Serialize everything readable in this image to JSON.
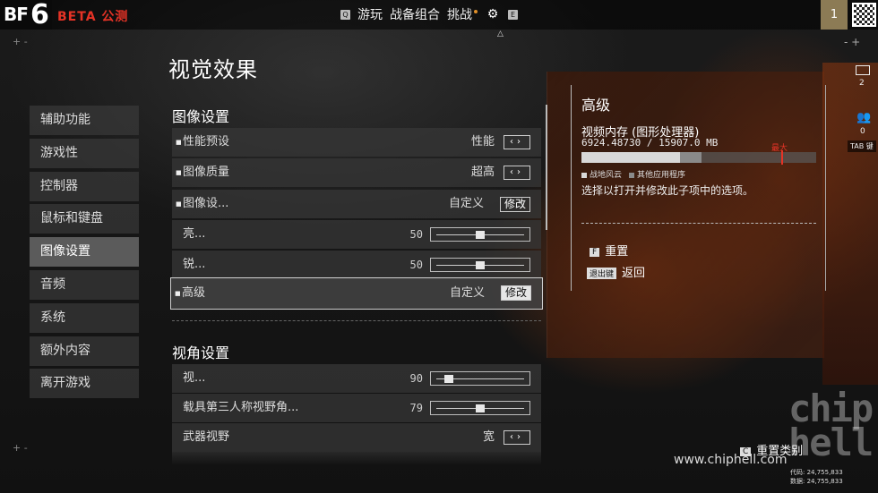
{
  "header": {
    "logo_bf": "BF",
    "logo_6": "6",
    "beta_label": "BETA 公测",
    "nav": [
      {
        "key": "Q",
        "label": "游玩"
      },
      {
        "key": "",
        "label": "战备组合"
      },
      {
        "key": "",
        "label": "挑战"
      },
      {
        "key": "E",
        "label": ""
      }
    ],
    "gear_key": "△",
    "level": "1",
    "zoom_out": "+ -",
    "zoom_in": "- +"
  },
  "page_title": "视觉效果",
  "sidebar": {
    "items": [
      {
        "label": "辅助功能",
        "active": false
      },
      {
        "label": "游戏性",
        "active": false
      },
      {
        "label": "控制器",
        "active": false
      },
      {
        "label": "鼠标和键盘",
        "active": false
      },
      {
        "label": "图像设置",
        "active": true
      },
      {
        "label": "音频",
        "active": false
      },
      {
        "label": "系统",
        "active": false
      },
      {
        "label": "额外内容",
        "active": false
      },
      {
        "label": "离开游戏",
        "active": false
      }
    ]
  },
  "image_settings": {
    "title": "图像设置",
    "rows": [
      {
        "label": "性能预设",
        "value": "性能",
        "control": "arrows"
      },
      {
        "label": "图像质量",
        "value": "超高",
        "control": "arrows"
      },
      {
        "label": "图像设...",
        "value": "自定义",
        "button": "修改"
      },
      {
        "label": "亮...",
        "number": "50",
        "slider": 0.5
      },
      {
        "label": "锐...",
        "number": "50",
        "slider": 0.5
      },
      {
        "label": "高级",
        "value": "自定义",
        "button": "修改"
      }
    ]
  },
  "view_settings": {
    "title": "视角设置",
    "rows": [
      {
        "label": "视...",
        "number": "90",
        "slider": 0.1
      },
      {
        "label": "载具第三人称视野角...",
        "number": "79",
        "slider": 0.5
      },
      {
        "label": "武器视野",
        "value": "宽",
        "control": "arrows"
      }
    ]
  },
  "right_panel": {
    "title": "高级",
    "vram_label": "视频内存 (图形处理器)",
    "vram_values": "6924.48730 / 15907.0 MB",
    "max_label": "最大",
    "vram": {
      "used_fraction": 0.42,
      "other_fraction": 0.09,
      "max_fraction": 0.85
    },
    "legend": [
      {
        "label": "战地风云",
        "color": "#d8d8d8"
      },
      {
        "label": "其他应用程序",
        "color": "#8a8a8a"
      }
    ],
    "description": "选择以打开并修改此子项中的选项。",
    "actions": [
      {
        "key": "F",
        "label": "重置"
      },
      {
        "key": "退出键",
        "label": "返回"
      }
    ]
  },
  "side_icons": {
    "mail_count": "2",
    "users_count": "0",
    "tab_label": "TAB 键"
  },
  "footer": {
    "reset_key": "C",
    "reset_label": "重置类别",
    "watermark": "www.chiphell.com",
    "code_line1": "代码: 24,755,833",
    "code_line2": "数据: 24,755,833"
  },
  "colors": {
    "accent": "#e53326",
    "panel_bg": "#373737"
  }
}
